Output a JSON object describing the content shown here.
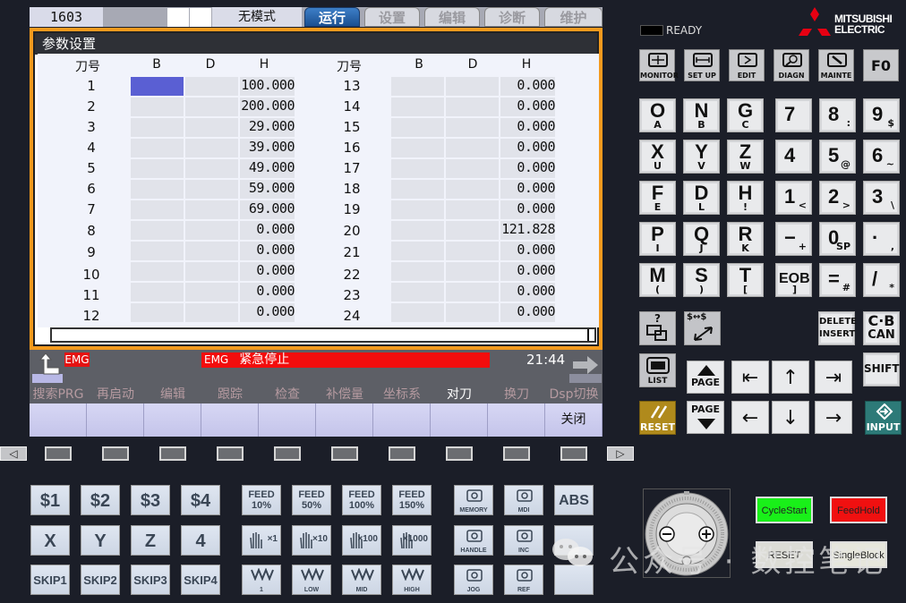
{
  "topbar": {
    "program_number": "1603",
    "mode": "无模式",
    "tabs": [
      {
        "label": "运行",
        "active": true
      },
      {
        "label": "设置",
        "active": false
      },
      {
        "label": "编辑",
        "active": false
      },
      {
        "label": "诊断",
        "active": false
      },
      {
        "label": "维护",
        "active": false
      }
    ]
  },
  "screen": {
    "title": "参数设置",
    "columns": [
      "刀号",
      "B",
      "D",
      "H"
    ],
    "left_rows": [
      {
        "no": "1",
        "B": "",
        "D": "",
        "H": "100.000"
      },
      {
        "no": "2",
        "B": "",
        "D": "",
        "H": "200.000"
      },
      {
        "no": "3",
        "B": "",
        "D": "",
        "H": "29.000"
      },
      {
        "no": "4",
        "B": "",
        "D": "",
        "H": "39.000"
      },
      {
        "no": "5",
        "B": "",
        "D": "",
        "H": "49.000"
      },
      {
        "no": "6",
        "B": "",
        "D": "",
        "H": "59.000"
      },
      {
        "no": "7",
        "B": "",
        "D": "",
        "H": "69.000"
      },
      {
        "no": "8",
        "B": "",
        "D": "",
        "H": "0.000"
      },
      {
        "no": "9",
        "B": "",
        "D": "",
        "H": "0.000"
      },
      {
        "no": "10",
        "B": "",
        "D": "",
        "H": "0.000"
      },
      {
        "no": "11",
        "B": "",
        "D": "",
        "H": "0.000"
      },
      {
        "no": "12",
        "B": "",
        "D": "",
        "H": "0.000"
      }
    ],
    "right_rows": [
      {
        "no": "13",
        "B": "",
        "D": "",
        "H": "0.000"
      },
      {
        "no": "14",
        "B": "",
        "D": "",
        "H": "0.000"
      },
      {
        "no": "15",
        "B": "",
        "D": "",
        "H": "0.000"
      },
      {
        "no": "16",
        "B": "",
        "D": "",
        "H": "0.000"
      },
      {
        "no": "17",
        "B": "",
        "D": "",
        "H": "0.000"
      },
      {
        "no": "18",
        "B": "",
        "D": "",
        "H": "0.000"
      },
      {
        "no": "19",
        "B": "",
        "D": "",
        "H": "0.000"
      },
      {
        "no": "20",
        "B": "",
        "D": "",
        "H": "121.828"
      },
      {
        "no": "21",
        "B": "",
        "D": "",
        "H": "0.000"
      },
      {
        "no": "22",
        "B": "",
        "D": "",
        "H": "0.000"
      },
      {
        "no": "23",
        "B": "",
        "D": "",
        "H": "0.000"
      },
      {
        "no": "24",
        "B": "",
        "D": "",
        "H": "0.000"
      }
    ],
    "selected_cell": "1-B",
    "input_value": ""
  },
  "status": {
    "emg_short": "EMG",
    "emg_code": "EMG",
    "emg_message": "紧急停止",
    "time": "21:44"
  },
  "softkey_labels": [
    "搜索PRG",
    "再启动",
    "编辑",
    "跟踪",
    "检查",
    "补偿量",
    "坐标系",
    "对刀",
    "换刀",
    "Dsp切换"
  ],
  "softkey_active_index": 7,
  "softkeys": [
    "",
    "",
    "",
    "",
    "",
    "",
    "",
    "",
    "",
    "关闭"
  ],
  "function_keys": {
    "count": 10,
    "prev": "◁",
    "next": "▷"
  },
  "right_panel": {
    "ready_label": "READY",
    "brand_line1": "MITSUBISHI",
    "brand_line2": "ELECTRIC",
    "mode_keys": [
      "MONITOR",
      "SET UP",
      "EDIT",
      "DIAGN",
      "MAINTE",
      "F0"
    ],
    "letter_keys": [
      {
        "main": "O",
        "sub": "A"
      },
      {
        "main": "N",
        "sub": "B"
      },
      {
        "main": "G",
        "sub": "C"
      },
      {
        "main": "X",
        "sub": "U"
      },
      {
        "main": "Y",
        "sub": "V"
      },
      {
        "main": "Z",
        "sub": "W"
      },
      {
        "main": "F",
        "sub": "E"
      },
      {
        "main": "D",
        "sub": "L"
      },
      {
        "main": "H",
        "sub": "!"
      },
      {
        "main": "P",
        "sub": "I"
      },
      {
        "main": "Q",
        "sub": "J"
      },
      {
        "main": "R",
        "sub": "K"
      },
      {
        "main": "M",
        "sub": "("
      },
      {
        "main": "S",
        "sub": ")"
      },
      {
        "main": "T",
        "sub": "["
      }
    ],
    "number_keys": [
      {
        "main": "7",
        "sub": ""
      },
      {
        "main": "8",
        "sub": ":"
      },
      {
        "main": "9",
        "sub": "$"
      },
      {
        "main": "4",
        "sub": ""
      },
      {
        "main": "5",
        "sub": "@"
      },
      {
        "main": "6",
        "sub": "~"
      },
      {
        "main": "1",
        "sub": "<"
      },
      {
        "main": "2",
        "sub": ">"
      },
      {
        "main": "3",
        "sub": "\\"
      },
      {
        "main": "−",
        "sub": "+"
      },
      {
        "main": "0",
        "sub": "SP"
      },
      {
        "main": "·",
        "sub": ","
      },
      {
        "main": "EOB",
        "sub": "]"
      },
      {
        "main": "=",
        "sub": "#"
      },
      {
        "main": "/",
        "sub": "*"
      }
    ],
    "help_key": "?",
    "swap_key": "$↔$",
    "delete_insert": [
      "DELETE",
      "INSERT"
    ],
    "cb_can": [
      "C·B",
      "CAN"
    ],
    "list_key": "LIST",
    "page_up": "PAGE",
    "page_down": "PAGE",
    "shift_key": "SHIFT",
    "reset_key": "RESET",
    "input_key": "INPUT",
    "arrows": {
      "home": "⇤",
      "up": "↑",
      "end": "⇥",
      "left": "←",
      "down": "↓",
      "right": "→"
    }
  },
  "operator_panel": {
    "col1": [
      "$1",
      "X",
      "SKIP1"
    ],
    "col2": [
      "$2",
      "Y",
      "SKIP2"
    ],
    "col3": [
      "$3",
      "Z",
      "SKIP3"
    ],
    "col4": [
      "$4",
      "4",
      "SKIP4"
    ],
    "feed": [
      {
        "top": "FEED",
        "bottom": "10%"
      },
      {
        "top": "FEED",
        "bottom": "50%"
      },
      {
        "top": "FEED",
        "bottom": "100%"
      },
      {
        "top": "FEED",
        "bottom": "150%"
      }
    ],
    "handle_mult": [
      "×1",
      "×10",
      "×100",
      "×1000"
    ],
    "rapid": [
      "1",
      "LOW",
      "MID",
      "HIGH"
    ],
    "modes": [
      "MEMORY",
      "MDI",
      "ABS",
      "HANDLE",
      "INC",
      "",
      "JOG",
      "REF",
      ""
    ],
    "cycle_start": "CycleStart",
    "feed_hold": "FeedHold",
    "reset": "RESET",
    "single_block": "SingleBlock"
  },
  "watermark": "公众号 · 数控笔记",
  "colors": {
    "accent_orange": "#f39a1e",
    "tab_active": "#1b4f90",
    "emg_red": "#f30d0d",
    "cycle_start_green": "#19f019",
    "feed_hold_red": "#f01010",
    "reset_gold": "#b08a1c",
    "input_teal": "#2d7a78"
  }
}
